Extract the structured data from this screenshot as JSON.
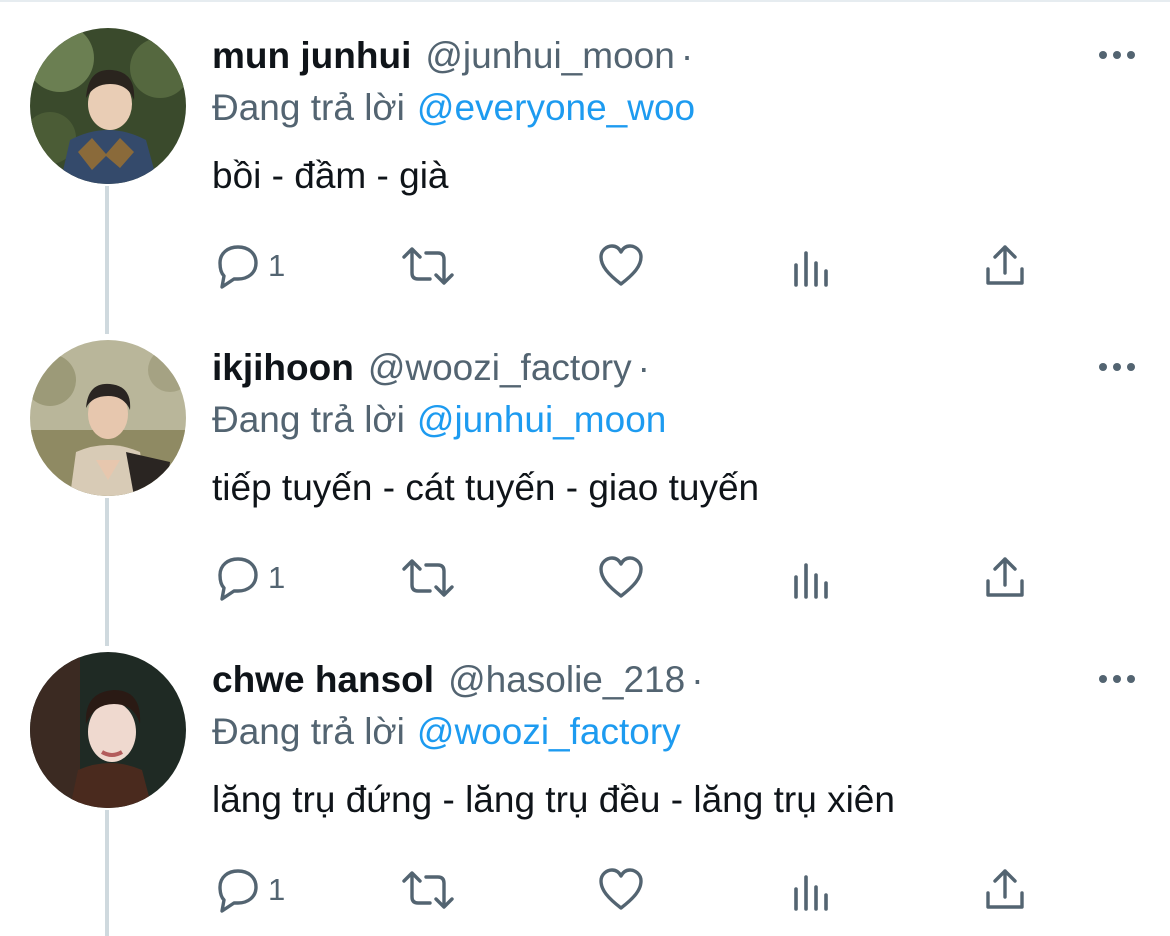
{
  "tweets": [
    {
      "name": "mun junhui",
      "handle": "@junhui_moon",
      "separator": "·",
      "reply_prefix": "Đang trả lời",
      "reply_to": "@everyone_woo",
      "text": "bồi - đầm - già",
      "reply_count": "1",
      "avatar_colors": [
        "#3a4a2c",
        "#6b7f52",
        "#c9b08a",
        "#344a6b",
        "#8a6a3a"
      ]
    },
    {
      "name": "ikjihoon",
      "handle": "@woozi_factory",
      "separator": "·",
      "reply_prefix": "Đang trả lời",
      "reply_to": "@junhui_moon",
      "text": "tiếp tuyến - cát tuyến - giao tuyến",
      "reply_count": "1",
      "avatar_colors": [
        "#b9b69a",
        "#8f8a63",
        "#e7c7ae",
        "#2a2522",
        "#d8cbb6"
      ]
    },
    {
      "name": "chwe hansol",
      "handle": "@hasolie_218",
      "separator": "·",
      "reply_prefix": "Đang trả lời",
      "reply_to": "@woozi_factory",
      "text": "lăng trụ đứng - lăng trụ đều - lăng trụ xiên",
      "reply_count": "1",
      "avatar_colors": [
        "#1f2a24",
        "#3b2a22",
        "#efd9cf",
        "#4a2a1e",
        "#b35c5c"
      ]
    }
  ],
  "icons": {
    "reply": "reply-icon",
    "retweet": "retweet-icon",
    "like": "heart-icon",
    "analytics": "analytics-icon",
    "share": "share-icon",
    "more": "more-icon"
  },
  "colors": {
    "text": "#0f1419",
    "secondary": "#536471",
    "link": "#1d9bf0",
    "thread_line": "#cfd9de",
    "icon": "#536471"
  }
}
